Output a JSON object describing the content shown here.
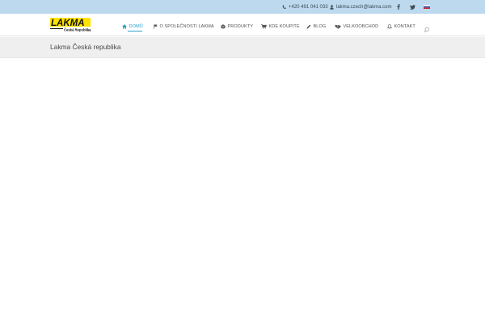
{
  "topbar": {
    "phone": "+420 491 041 033",
    "email": "lakma.czech@lakma.com",
    "social": [
      "facebook-icon",
      "twitter-icon"
    ],
    "flag": "slovak-flag-icon",
    "background": "#bcd9ee"
  },
  "logo": {
    "text": "LAKMA",
    "subtext": "Česká Republika s.r.o.",
    "colors": {
      "yellow": "#ffe200",
      "black": "#111111"
    }
  },
  "nav": {
    "accent": "#2aa0cc",
    "items": [
      {
        "label": "DOMŮ",
        "icon": "home-icon",
        "active": true
      },
      {
        "label": "O SPOLEČNOSTI LAKMA",
        "icon": "flag-icon",
        "active": false
      },
      {
        "label": "PRODUKTY",
        "icon": "cube-icon",
        "active": false
      },
      {
        "label": "KDE KOUPITE",
        "icon": "cart-icon",
        "active": false
      },
      {
        "label": "BLOG",
        "icon": "pencil-icon",
        "active": false
      },
      {
        "label": "VELKOOBCHOD",
        "icon": "handshake-icon",
        "active": false
      },
      {
        "label": "KONTAKT",
        "icon": "bell-icon",
        "active": false
      }
    ],
    "search_icon": "search-icon"
  },
  "page": {
    "title": "Lakma Česká republika"
  }
}
